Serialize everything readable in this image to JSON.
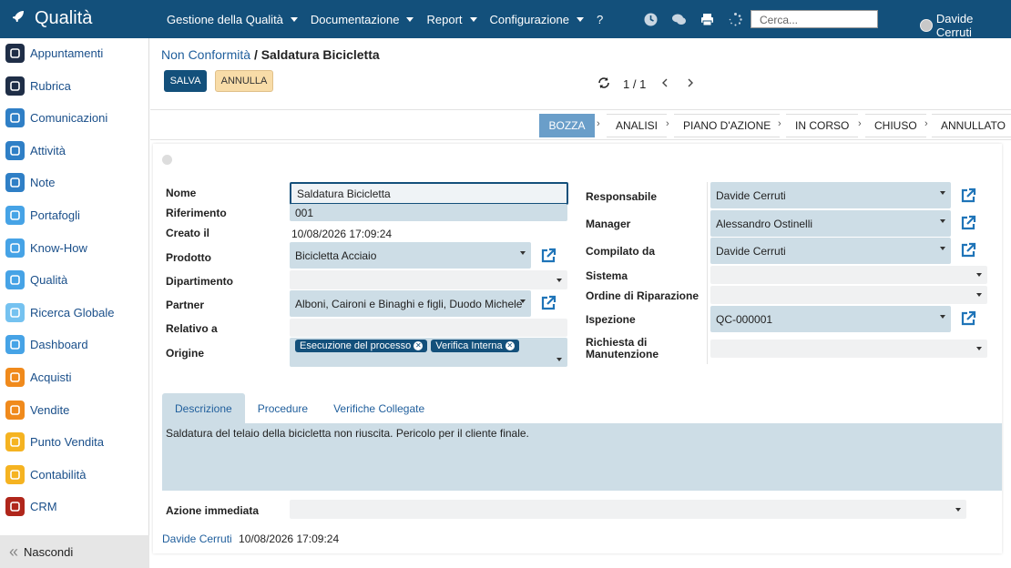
{
  "app": {
    "name": "Qualità"
  },
  "nav": {
    "menus": [
      "Gestione della Qualità",
      "Documentazione",
      "Report",
      "Configurazione",
      "?"
    ],
    "search_placeholder": "Cerca...",
    "user": "Davide Cerruti"
  },
  "sidebar": {
    "items": [
      {
        "label": "Appuntamenti",
        "color": "#1f2e47"
      },
      {
        "label": "Rubrica",
        "color": "#1f2e47"
      },
      {
        "label": "Comunicazioni",
        "color": "#2f7fc6"
      },
      {
        "label": "Attività",
        "color": "#2f7fc6"
      },
      {
        "label": "Note",
        "color": "#2f7fc6"
      },
      {
        "label": "Portafogli",
        "color": "#46a3e6"
      },
      {
        "label": "Know-How",
        "color": "#46a3e6"
      },
      {
        "label": "Qualità",
        "color": "#46a3e6"
      },
      {
        "label": "Ricerca Globale",
        "color": "#75c2f0"
      },
      {
        "label": "Dashboard",
        "color": "#46a3e6"
      },
      {
        "label": "Acquisti",
        "color": "#f08a1c"
      },
      {
        "label": "Vendite",
        "color": "#f08a1c"
      },
      {
        "label": "Punto Vendita",
        "color": "#f5b321"
      },
      {
        "label": "Contabilità",
        "color": "#f5b321"
      },
      {
        "label": "CRM",
        "color": "#b0261b"
      }
    ],
    "hide_label": "Nascondi"
  },
  "breadcrumb": {
    "parent": "Non Conformità",
    "separator": "/",
    "current": "Saldatura Bicicletta"
  },
  "toolbar": {
    "save": "SALVA",
    "cancel": "ANNULLA",
    "pager": "1 / 1"
  },
  "stages": [
    "BOZZA",
    "ANALISI",
    "PIANO D'AZIONE",
    "IN CORSO",
    "CHIUSO",
    "ANNULLATO"
  ],
  "form": {
    "left": {
      "nome": {
        "label": "Nome",
        "value": "Saldatura Bicicletta"
      },
      "riferimento": {
        "label": "Riferimento",
        "value": "001"
      },
      "creato": {
        "label": "Creato il",
        "value": "10/08/2026 17:09:24"
      },
      "prodotto": {
        "label": "Prodotto",
        "value": "Bicicletta Acciaio"
      },
      "dipartimento": {
        "label": "Dipartimento",
        "value": ""
      },
      "partner": {
        "label": "Partner",
        "value": "Alboni, Caironi e Binaghi e figli, Duodo Michele"
      },
      "relativo": {
        "label": "Relativo a",
        "value": ""
      },
      "origine": {
        "label": "Origine",
        "tags": [
          "Esecuzione del processo",
          "Verifica Interna"
        ]
      }
    },
    "right": {
      "responsabile": {
        "label": "Responsabile",
        "value": "Davide Cerruti"
      },
      "manager": {
        "label": "Manager",
        "value": "Alessandro Ostinelli"
      },
      "compilato": {
        "label": "Compilato da",
        "value": "Davide Cerruti"
      },
      "sistema": {
        "label": "Sistema",
        "value": ""
      },
      "ordine": {
        "label": "Ordine di Riparazione",
        "value": ""
      },
      "ispezione": {
        "label": "Ispezione",
        "value": "QC-000001"
      },
      "richiesta": {
        "label_line1": "Richiesta di",
        "label_line2": "Manutenzione",
        "value": ""
      }
    }
  },
  "tabs": [
    "Descrizione",
    "Procedure",
    "Verifiche Collegate"
  ],
  "description": "Saldatura del telaio della bicicletta non riuscita. Pericolo per il cliente finale.",
  "azione": {
    "label": "Azione immediata",
    "value": ""
  },
  "footer": {
    "user": "Davide Cerruti",
    "timestamp": "10/08/2026 17:09:24"
  }
}
